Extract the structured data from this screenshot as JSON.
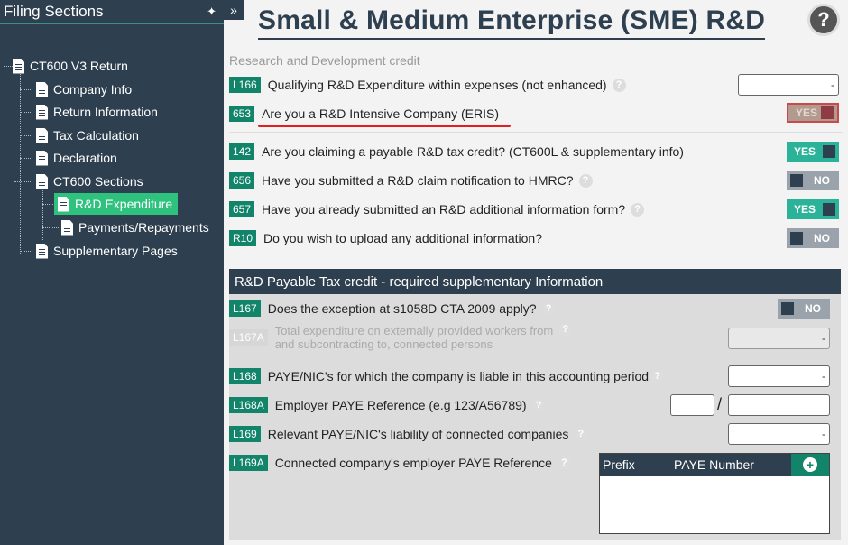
{
  "sidebar": {
    "title": "Filing Sections",
    "items": [
      {
        "label": "CT600 V3 Return"
      },
      {
        "label": "Company Info"
      },
      {
        "label": "Return Information"
      },
      {
        "label": "Tax Calculation"
      },
      {
        "label": "Declaration"
      },
      {
        "label": "CT600 Sections"
      },
      {
        "label": "R&D Expenditure"
      },
      {
        "label": "Payments/Repayments"
      },
      {
        "label": "Supplementary Pages"
      }
    ]
  },
  "header": {
    "title": "Small & Medium Enterprise (SME) R&D",
    "help": "?",
    "collapse": "»",
    "pin": "✦"
  },
  "section": {
    "label": "Research and Development credit"
  },
  "questions": [
    {
      "code": "L166",
      "text": "Qualifying R&D Expenditure within expenses (not enhanced)",
      "value": "-"
    },
    {
      "code": "653",
      "text": "Are you a R&D Intensive Company (ERIS)",
      "toggle": "YES"
    },
    {
      "code": "142",
      "text": "Are you claiming a payable R&D tax credit? (CT600L & supplementary info)",
      "toggle": "YES"
    },
    {
      "code": "656",
      "text": "Have you submitted a R&D claim notification to HMRC?",
      "toggle": "NO"
    },
    {
      "code": "657",
      "text": "Have you already submitted an R&D additional information form?",
      "toggle": "YES"
    },
    {
      "code": "R10",
      "text": "Do you wish to upload any additional information?",
      "toggle": "NO"
    }
  ],
  "panel": {
    "title": "R&D Payable Tax credit - required supplementary Information",
    "rows": [
      {
        "code": "L167",
        "text": "Does the exception at s1058D CTA 2009 apply?",
        "toggle": "NO"
      },
      {
        "code": "L167A",
        "text1": "Total expenditure on externally provided workers from",
        "text2": "and subcontracting to, connected persons",
        "value": "-"
      },
      {
        "code": "L168",
        "text": "PAYE/NIC's for which the company is liable in this accounting period",
        "value": "-"
      },
      {
        "code": "L168A",
        "text": "Employer PAYE Reference (e.g 123/A56789)",
        "slash": "/"
      },
      {
        "code": "L169",
        "text": "Relevant PAYE/NIC's liability of connected companies",
        "value": "-"
      },
      {
        "code": "L169A",
        "text": "Connected company's employer PAYE Reference"
      }
    ],
    "table": {
      "col_prefix": "Prefix",
      "col_paye": "PAYE Number",
      "add": "+"
    }
  },
  "colors": {
    "navy": "#2e3f50",
    "green": "#11846a",
    "toggle_yes": "#2bb39a",
    "active": "#2ec27e"
  }
}
